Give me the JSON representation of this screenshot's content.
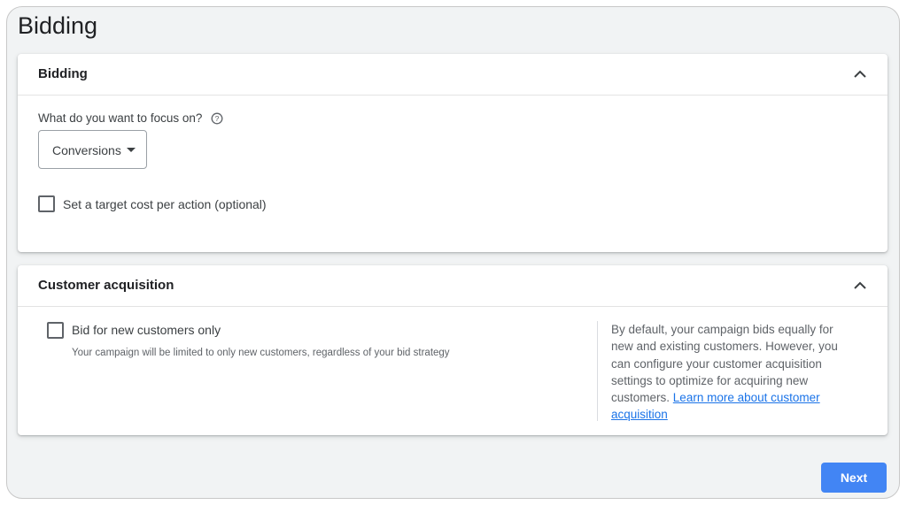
{
  "page": {
    "title": "Bidding"
  },
  "bidding_card": {
    "title": "Bidding",
    "focus_label": "What do you want to focus on?",
    "focus_value": "Conversions",
    "target_cpa_label": "Set a target cost per action (optional)"
  },
  "acquisition_card": {
    "title": "Customer acquisition",
    "new_customers_label": "Bid for new customers only",
    "new_customers_helper": "Your campaign will be limited to only new customers, regardless of your bid strategy",
    "info_text": "By default, your campaign bids equally for new and existing customers. However, you can configure your customer acquisition settings to optimize for acquiring new customers.",
    "learn_more_link": "Learn more about customer acquisition"
  },
  "footer": {
    "next_label": "Next"
  },
  "colors": {
    "accent": "#4285f4",
    "link": "#1a73e8",
    "background": "#f1f3f4"
  }
}
